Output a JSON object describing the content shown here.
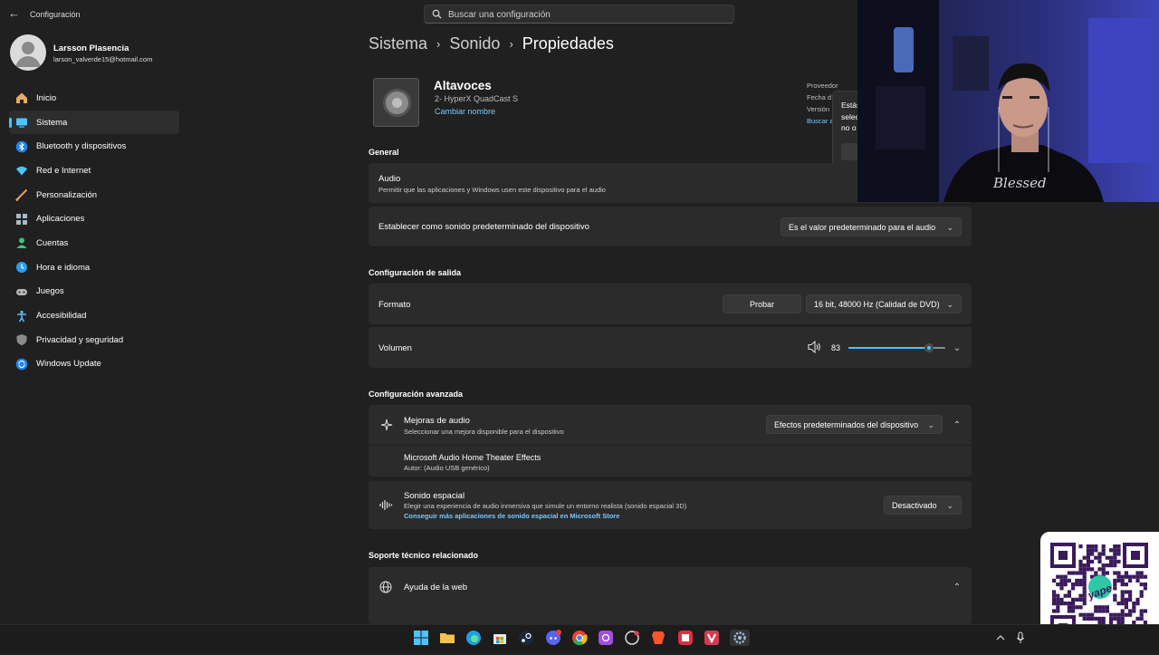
{
  "app": {
    "title": "Configuración"
  },
  "search": {
    "placeholder": "Buscar una configuración"
  },
  "user": {
    "name": "Larsson Plasencia",
    "email": "larson_valverde15@hotmail.com"
  },
  "nav": [
    {
      "label": "Inicio",
      "icon": "home-icon",
      "color": "#f0b27a"
    },
    {
      "label": "Sistema",
      "icon": "monitor-icon",
      "color": "#4cc2ff"
    },
    {
      "label": "Bluetooth y dispositivos",
      "icon": "bluetooth-icon",
      "color": "#4cc2ff"
    },
    {
      "label": "Red e Internet",
      "icon": "wifi-icon",
      "color": "#4cc2ff"
    },
    {
      "label": "Personalización",
      "icon": "brush-icon",
      "color": "#e8a060"
    },
    {
      "label": "Aplicaciones",
      "icon": "apps-icon",
      "color": "#9ab"
    },
    {
      "label": "Cuentas",
      "icon": "person-icon",
      "color": "#3ec27f"
    },
    {
      "label": "Hora e idioma",
      "icon": "globe-clock-icon",
      "color": "#4cc2ff"
    },
    {
      "label": "Juegos",
      "icon": "gamepad-icon",
      "color": "#aaa"
    },
    {
      "label": "Accesibilidad",
      "icon": "accessibility-icon",
      "color": "#4cc2ff"
    },
    {
      "label": "Privacidad y seguridad",
      "icon": "shield-icon",
      "color": "#9a9a9a"
    },
    {
      "label": "Windows Update",
      "icon": "update-icon",
      "color": "#4cc2ff"
    }
  ],
  "breadcrumb": {
    "c1": "Sistema",
    "c2": "Sonido",
    "current": "Propiedades"
  },
  "device": {
    "name": "Altavoces",
    "subtitle": "2- HyperX QuadCast S",
    "rename": "Cambiar nombre"
  },
  "meta": {
    "proveedor": "Proveedor",
    "fecha": "Fecha d",
    "version": "Versión",
    "buscar": "Buscar a"
  },
  "popup": {
    "line1": "Estás",
    "line2": "selec",
    "line3": "no o"
  },
  "general": {
    "title": "General",
    "audio_title": "Audio",
    "audio_sub": "Permitir que las aplicaciones y Windows usen este dispositivo para el audio",
    "default_label": "Establecer como sonido predeterminado del dispositivo",
    "default_value": "Es el valor predeterminado para el audio"
  },
  "output": {
    "title": "Configuración de salida",
    "format_label": "Formato",
    "test_button": "Probar",
    "format_value": "16 bit, 48000 Hz (Calidad de DVD)",
    "volume_label": "Volumen",
    "volume_value": "83",
    "volume_level": 83
  },
  "advanced": {
    "title": "Configuración avanzada",
    "enh_title": "Mejoras de audio",
    "enh_sub": "Seleccionar una mejora disponible para el dispositivo",
    "enh_value": "Efectos predeterminados del dispositivo",
    "effect_title": "Microsoft Audio Home Theater Effects",
    "effect_sub": "Autor: (Audio USB genérico)",
    "spatial_title": "Sonido espacial",
    "spatial_sub": "Elegir una experiencia de audio inmersiva que simule un entorno realista (sonido espacial 3D)",
    "spatial_link": "Conseguir más aplicaciones de sonido espacial en Microsoft Store",
    "spatial_value": "Desactivado"
  },
  "support": {
    "title": "Soporte técnico relacionado",
    "web_help": "Ayuda de la web"
  },
  "overlay": {
    "shirt_text": "Blessed",
    "qr_brand": "yape"
  },
  "colors": {
    "accent": "#4cc2ff",
    "link": "#78c8ff",
    "bg": "#202020",
    "card": "#2b2b2b"
  }
}
